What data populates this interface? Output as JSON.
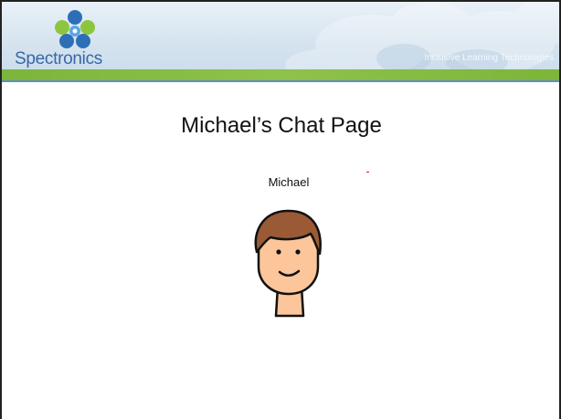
{
  "header": {
    "brand_name": "Spectronics",
    "tagline": "Inclusive Learning Technologies"
  },
  "main": {
    "title": "Michael’s Chat Page",
    "person": {
      "name": "Michael",
      "avatar_icon": "boy-face-icon"
    }
  },
  "colors": {
    "header_green": "#7cb53a",
    "brand_blue": "#3a67a8",
    "logo_green": "#8cc63f",
    "logo_blue": "#2d6fb7",
    "skin": "#fcc59a",
    "hair": "#9a5a36"
  }
}
